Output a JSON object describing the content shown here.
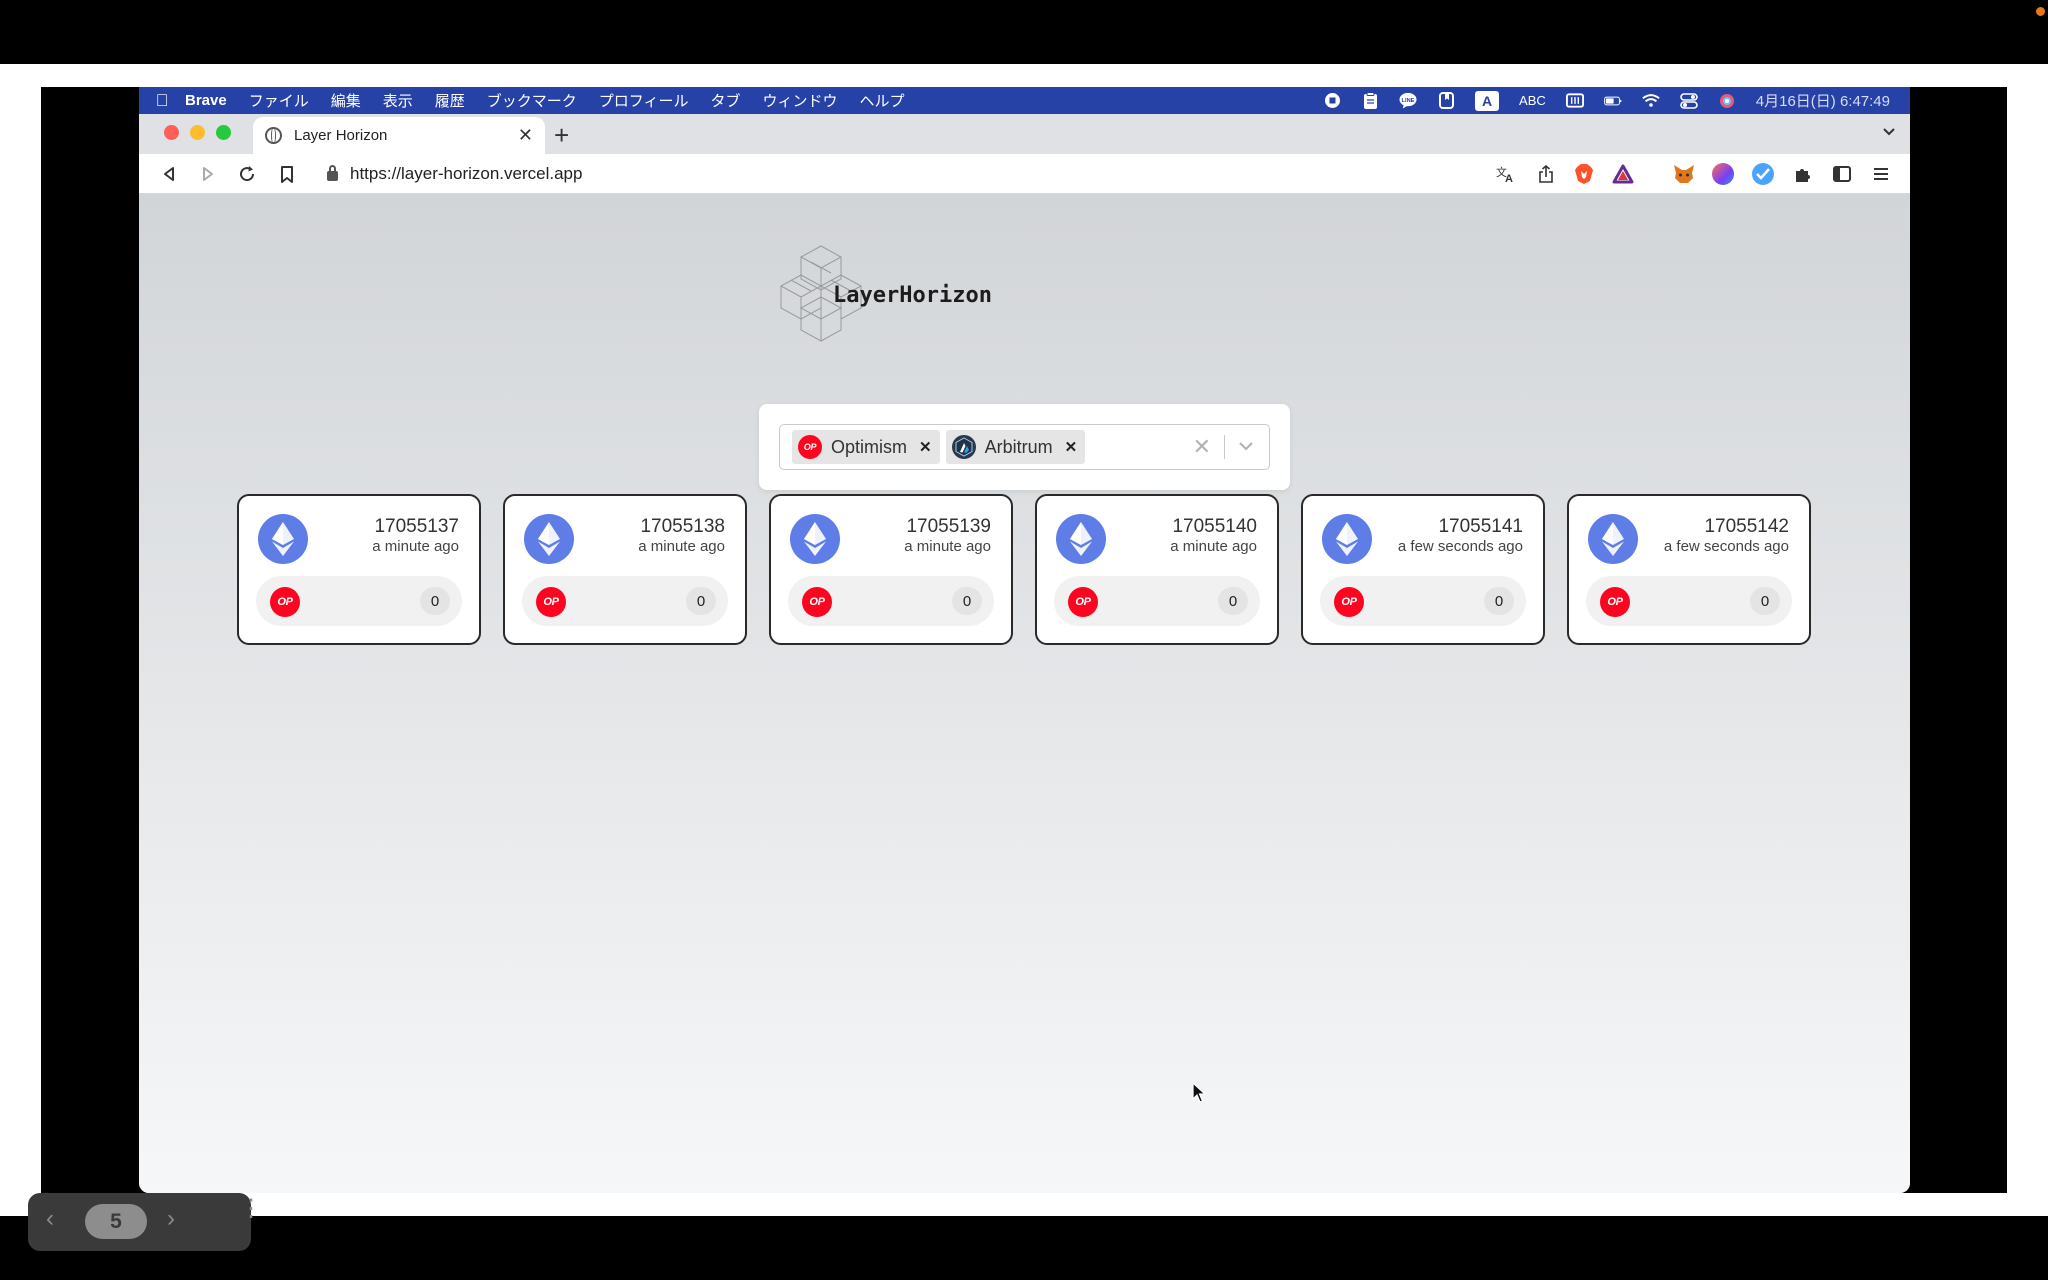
{
  "menubar": {
    "app_name": "Brave",
    "items": [
      "ファイル",
      "編集",
      "表示",
      "履歴",
      "ブックマーク",
      "プロフィール",
      "タブ",
      "ウィンドウ",
      "ヘルプ"
    ],
    "input_mode": "ABC",
    "input_badge": "A",
    "clock": "4月16日(日) 6:47:49"
  },
  "browser": {
    "tab_title": "Layer Horizon",
    "url": "https://layer-horizon.vercel.app"
  },
  "app": {
    "logo_text": "LayerHorizon",
    "selected_chains": [
      {
        "label": "Optimism",
        "badge": "OP"
      },
      {
        "label": "Arbitrum"
      }
    ],
    "blocks": [
      {
        "number": "17055137",
        "time": "a minute ago",
        "rollup_badge": "OP",
        "count": "0"
      },
      {
        "number": "17055138",
        "time": "a minute ago",
        "rollup_badge": "OP",
        "count": "0"
      },
      {
        "number": "17055139",
        "time": "a minute ago",
        "rollup_badge": "OP",
        "count": "0"
      },
      {
        "number": "17055140",
        "time": "a minute ago",
        "rollup_badge": "OP",
        "count": "0"
      },
      {
        "number": "17055141",
        "time": "a few seconds ago",
        "rollup_badge": "OP",
        "count": "0"
      },
      {
        "number": "17055142",
        "time": "a few seconds ago",
        "rollup_badge": "OP",
        "count": "0"
      }
    ]
  },
  "player": {
    "page": "5"
  },
  "colors": {
    "menubar": "#2742a6",
    "op_red": "#ff0420",
    "eth_blue": "#5f7de6"
  }
}
